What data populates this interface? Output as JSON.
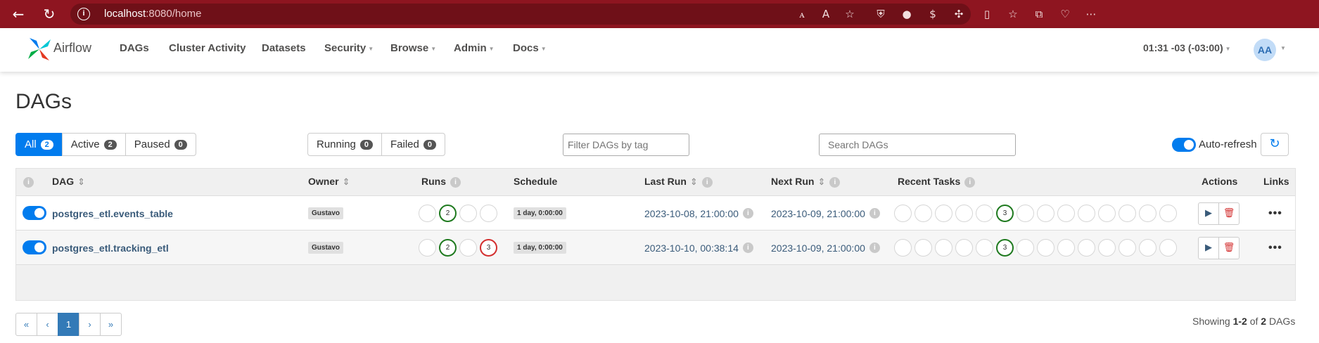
{
  "browser": {
    "url_host": "localhost",
    "url_rest": ":8080/home"
  },
  "navbar": {
    "brand": "Airflow",
    "items": [
      {
        "label": "DAGs",
        "dropdown": false
      },
      {
        "label": "Cluster Activity",
        "dropdown": false
      },
      {
        "label": "Datasets",
        "dropdown": false
      },
      {
        "label": "Security",
        "dropdown": true
      },
      {
        "label": "Browse",
        "dropdown": true
      },
      {
        "label": "Admin",
        "dropdown": true
      },
      {
        "label": "Docs",
        "dropdown": true
      }
    ],
    "timezone": "01:31 -03 (-03:00)",
    "avatar": "AA"
  },
  "page": {
    "title": "DAGs"
  },
  "filters": {
    "status": [
      {
        "label": "All",
        "count": "2"
      },
      {
        "label": "Active",
        "count": "2"
      },
      {
        "label": "Paused",
        "count": "0"
      }
    ],
    "state": [
      {
        "label": "Running",
        "count": "0"
      },
      {
        "label": "Failed",
        "count": "0"
      }
    ],
    "tag_placeholder": "Filter DAGs by tag",
    "search_placeholder": "Search DAGs",
    "auto_refresh": "Auto-refresh"
  },
  "table": {
    "headers": {
      "dag": "DAG",
      "owner": "Owner",
      "runs": "Runs",
      "schedule": "Schedule",
      "last_run": "Last Run",
      "next_run": "Next Run",
      "recent_tasks": "Recent Tasks",
      "actions": "Actions",
      "links": "Links"
    },
    "rows": [
      {
        "name": "postgres_etl.events_table",
        "owner": "Gustavo",
        "runs": [
          "",
          "2",
          "",
          ""
        ],
        "schedule": "1 day, 0:00:00",
        "last_run": "2023-10-08, 21:00:00",
        "next_run": "2023-10-09, 21:00:00",
        "recent_task_success": "3",
        "links": "•••"
      },
      {
        "name": "postgres_etl.tracking_etl",
        "owner": "Gustavo",
        "runs": [
          "",
          "2",
          "",
          "3"
        ],
        "schedule": "1 day, 0:00:00",
        "last_run": "2023-10-10, 00:38:14",
        "next_run": "2023-10-09, 21:00:00",
        "recent_task_success": "3",
        "links": "•••"
      }
    ]
  },
  "pagination": {
    "first": "«",
    "prev": "‹",
    "current": "1",
    "next": "›",
    "last": "»",
    "showing_prefix": "Showing",
    "showing_range": "1-2",
    "showing_of": "of",
    "showing_total": "2",
    "showing_suffix": "DAGs"
  },
  "colors": {
    "browser_bar": "#8e1520",
    "accent": "#017cee",
    "success": "#1f7a1f",
    "failed": "#d32f2f"
  }
}
